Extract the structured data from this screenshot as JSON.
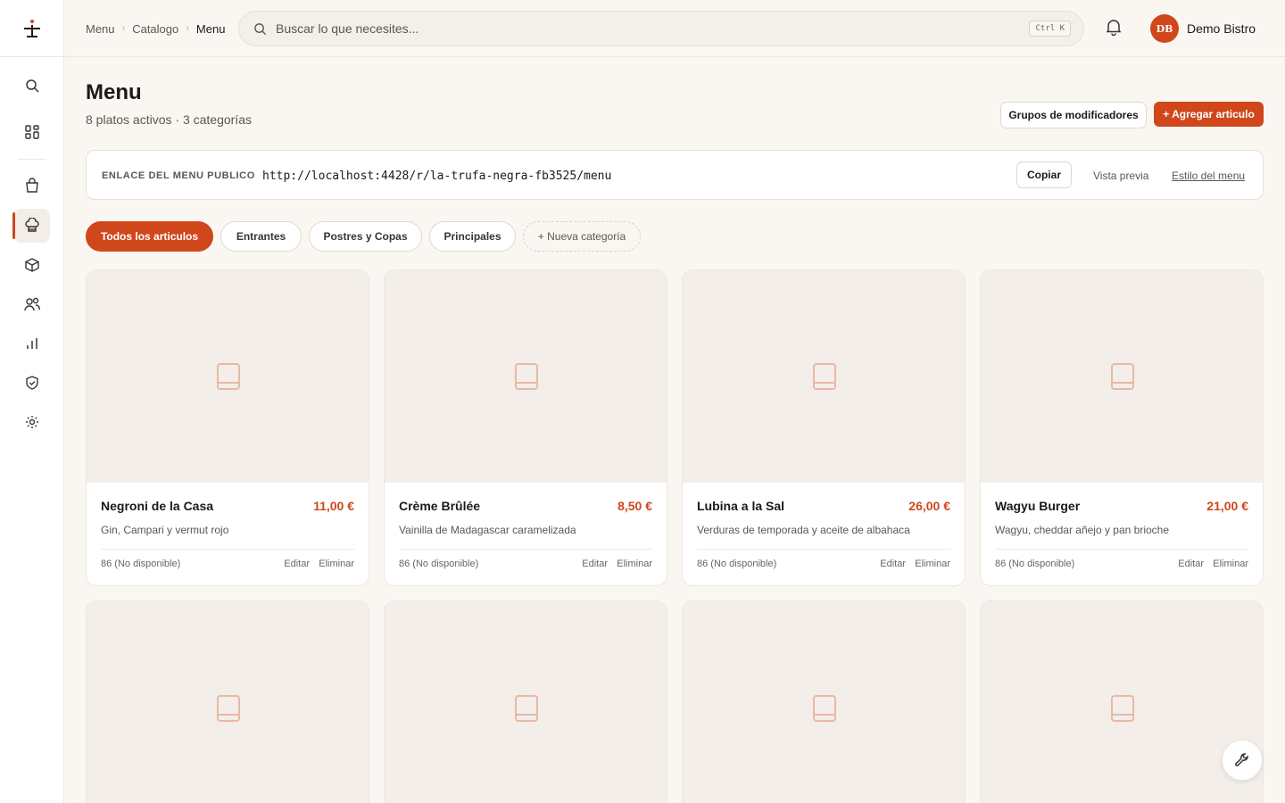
{
  "breadcrumb": {
    "item1": "Menu",
    "item2": "Catalogo",
    "current": "Menu"
  },
  "search": {
    "placeholder": "Buscar lo que necesites...",
    "shortcut": "Ctrl K"
  },
  "user": {
    "initials": "DB",
    "name": "Demo Bistro"
  },
  "page": {
    "title": "Menu",
    "subtitle": "8 platos activos · 3 categorías"
  },
  "actions": {
    "modifier_groups": "Grupos de modificadores",
    "add_item": "+ Agregar articulo"
  },
  "public_link": {
    "label": "ENLACE DEL MENU PUBLICO",
    "url": "http://localhost:4428/r/la-trufa-negra-fb3525/menu",
    "copy": "Copiar",
    "preview": "Vista previa",
    "style": "Estilo del menu"
  },
  "tabs": {
    "all": "Todos los articulos",
    "starters": "Entrantes",
    "desserts": "Postres y Copas",
    "mains": "Principales",
    "new": "+ Nueva categoría"
  },
  "items": [
    {
      "name": "Negroni de la Casa",
      "price": "11,00 €",
      "description": "Gin, Campari y vermut rojo",
      "stock": "86 (No disponible)",
      "edit": "Editar",
      "delete": "Eliminar"
    },
    {
      "name": "Crème Brûlée",
      "price": "8,50 €",
      "description": "Vainilla de Madagascar caramelizada",
      "stock": "86 (No disponible)",
      "edit": "Editar",
      "delete": "Eliminar"
    },
    {
      "name": "Lubina a la Sal",
      "price": "26,00 €",
      "description": "Verduras de temporada y aceite de albahaca",
      "stock": "86 (No disponible)",
      "edit": "Editar",
      "delete": "Eliminar"
    },
    {
      "name": "Wagyu Burger",
      "price": "21,00 €",
      "description": "Wagyu, cheddar añejo y pan brioche",
      "stock": "86 (No disponible)",
      "edit": "Editar",
      "delete": "Eliminar"
    }
  ],
  "colors": {
    "accent": "#d0471c",
    "background": "#faf7f3",
    "placeholder_bg": "#f3eee9",
    "placeholder_icon": "#e8b9a4"
  }
}
